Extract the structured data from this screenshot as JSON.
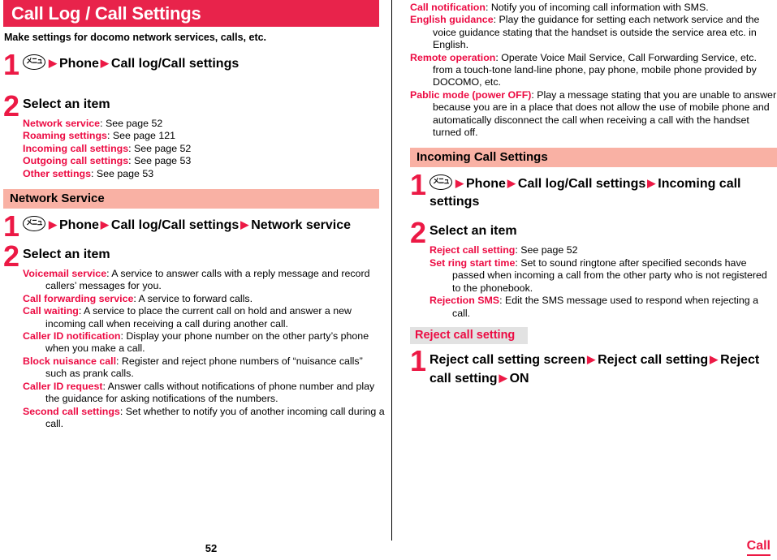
{
  "header": {
    "title": "Call Log / Call Settings",
    "subtitle": "Make settings for docomo network services, calls, etc.",
    "bar_color": "#e8234b"
  },
  "icons": {
    "menu_key": "メニュー",
    "arrow": "▶"
  },
  "left_column": {
    "intro_steps": [
      {
        "num": "1",
        "type": "operation",
        "parts": [
          "Phone",
          "Call log/Call settings"
        ]
      },
      {
        "num": "2",
        "type": "select",
        "title": "Select an item",
        "items": [
          {
            "term": "Network service",
            "desc": ": See page 52"
          },
          {
            "term": "Roaming settings",
            "desc": ": See page 121"
          },
          {
            "term": "Incoming call settings",
            "desc": ": See page 52"
          },
          {
            "term": "Outgoing call settings",
            "desc": ": See page 53"
          },
          {
            "term": "Other settings",
            "desc": ": See page 53"
          }
        ]
      }
    ],
    "section": {
      "band_label": "Network Service",
      "band_color": "#f9b1a4",
      "steps": [
        {
          "num": "1",
          "type": "operation",
          "parts": [
            "Phone",
            "Call log/Call settings",
            "Network service"
          ]
        },
        {
          "num": "2",
          "type": "select",
          "title": "Select an item",
          "items": [
            {
              "term": "Voicemail service",
              "desc": ": A service to answer calls with a reply message and record callers’ messages for you."
            },
            {
              "term": "Call forwarding service",
              "desc": ": A service to forward calls."
            },
            {
              "term": "Call waiting",
              "desc": ": A service to place the current call on hold and answer a new incoming call when receiving a call during another call."
            },
            {
              "term": "Caller ID notification",
              "desc": ": Display your phone number on the other party’s phone when you make a call."
            },
            {
              "term": "Block nuisance call",
              "desc": ": Register and reject phone numbers of “nuisance calls” such as prank calls."
            },
            {
              "term": "Caller ID request",
              "desc": ": Answer calls without notifications of phone number and play the guidance for asking notifications of the numbers."
            },
            {
              "term": "Second call settings",
              "desc": ": Set whether to notify you of another incoming call during a call."
            }
          ]
        }
      ]
    }
  },
  "right_column": {
    "continued_items": [
      {
        "term": "Call notification",
        "desc": ": Notify you of incoming call information with SMS."
      },
      {
        "term": "English guidance",
        "desc": ": Play the guidance for setting each network service and the voice guidance stating that the handset is outside the service area etc. in English."
      },
      {
        "term": "Remote operation",
        "desc": ": Operate Voice Mail Service, Call Forwarding Service, etc. from a touch-tone land-line phone, pay phone, mobile phone provided by DOCOMO, etc."
      },
      {
        "term": "Pablic mode (power OFF)",
        "desc": ": Play a message stating that you are unable to answer because you are in a place that does not allow the use of mobile phone and automatically disconnect the call when receiving a call with the handset turned off."
      }
    ],
    "section_incoming": {
      "band_label": "Incoming Call Settings",
      "band_color": "#f9b1a4",
      "steps": [
        {
          "num": "1",
          "type": "operation",
          "parts": [
            "Phone",
            "Call log/Call settings",
            "Incoming call settings"
          ]
        },
        {
          "num": "2",
          "type": "select",
          "title": "Select an item",
          "items": [
            {
              "term": "Reject call setting",
              "desc": ": See page 52"
            },
            {
              "term": "Set ring start time",
              "desc": ": Set to sound ringtone after specified seconds have passed when incoming a call from the other party who is not registered to the phonebook."
            },
            {
              "term": "Rejection SMS",
              "desc": ": Edit the SMS message used to respond when rejecting a call."
            }
          ]
        }
      ]
    },
    "section_reject": {
      "band_label": "Reject call setting",
      "band_color": "#e2e2e2",
      "band_text_color": "#ec0b43",
      "step": {
        "num": "1",
        "type": "operation-plain",
        "parts": [
          "Reject call setting screen",
          "Reject call setting",
          "Reject call setting",
          "ON"
        ]
      }
    }
  },
  "footer": {
    "page_number": "52",
    "tab_label": "Call",
    "tab_color": "#ec1945"
  }
}
